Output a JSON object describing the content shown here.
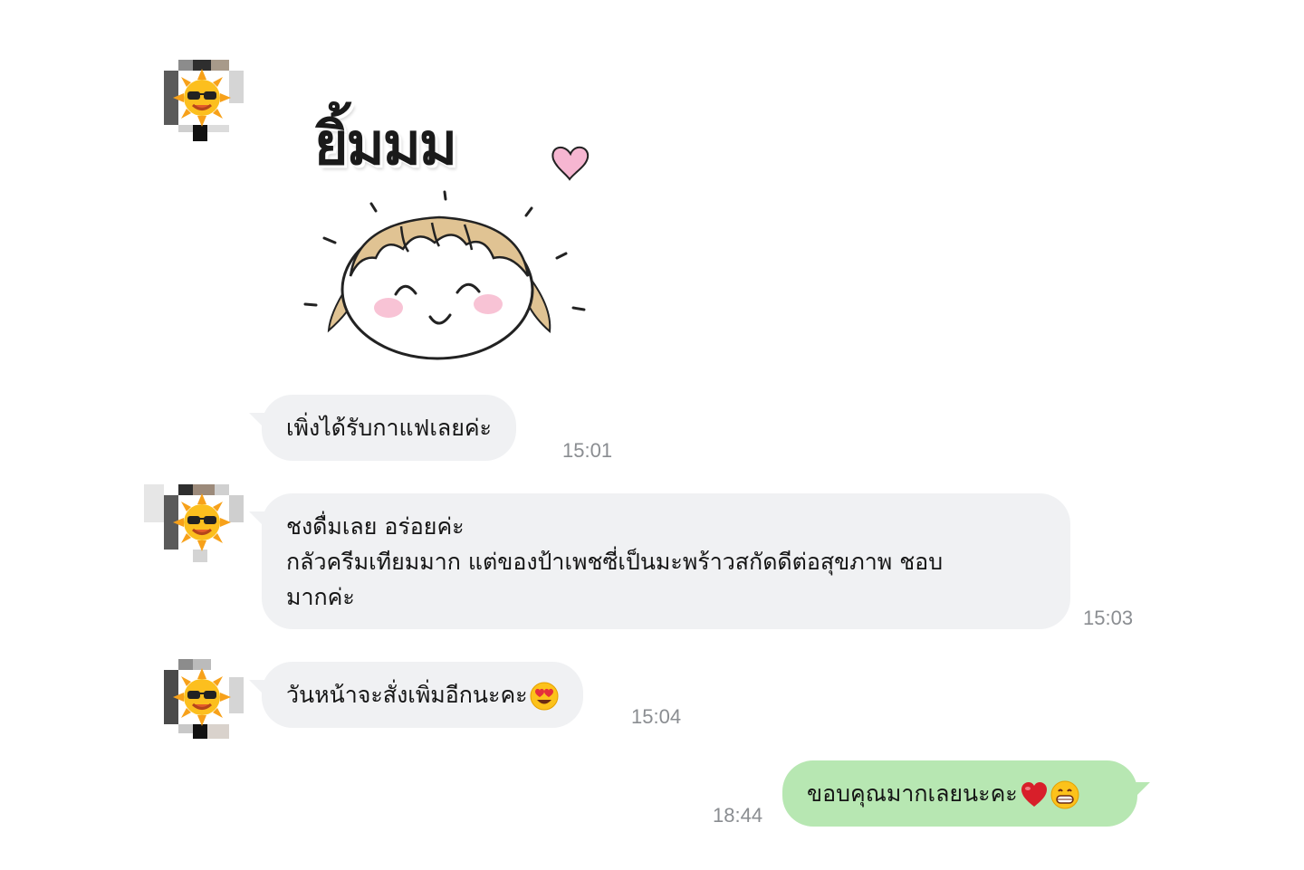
{
  "chat": {
    "sticker": {
      "caption": "ยิ้มมม"
    },
    "messages": [
      {
        "text": "เพิ่งได้รับกาแฟเลยค่ะ",
        "time": "15:01"
      },
      {
        "lines": [
          "ชงดื่มเลย อร่อยค่ะ",
          "กลัวครีมเทียมมาก แต่ของป้าเพชซี่เป็นมะพร้าวสกัดดีต่อสุขภาพ ชอบ",
          "มากค่ะ"
        ],
        "time": "15:03"
      },
      {
        "text": "วันหน้าจะสั่งเพิ่มอีกนะคะ",
        "emoji": "heart-eyes-emoji",
        "time": "15:04"
      },
      {
        "text": "ขอบคุณมากเลยนะคะ",
        "emoji": [
          "red-heart-emoji",
          "grinning-emoji"
        ],
        "time": "18:44"
      }
    ]
  },
  "colors": {
    "incoming_bubble": "#f0f1f3",
    "outgoing_bubble": "#b7e7b2",
    "timestamp": "#8a8d91"
  }
}
